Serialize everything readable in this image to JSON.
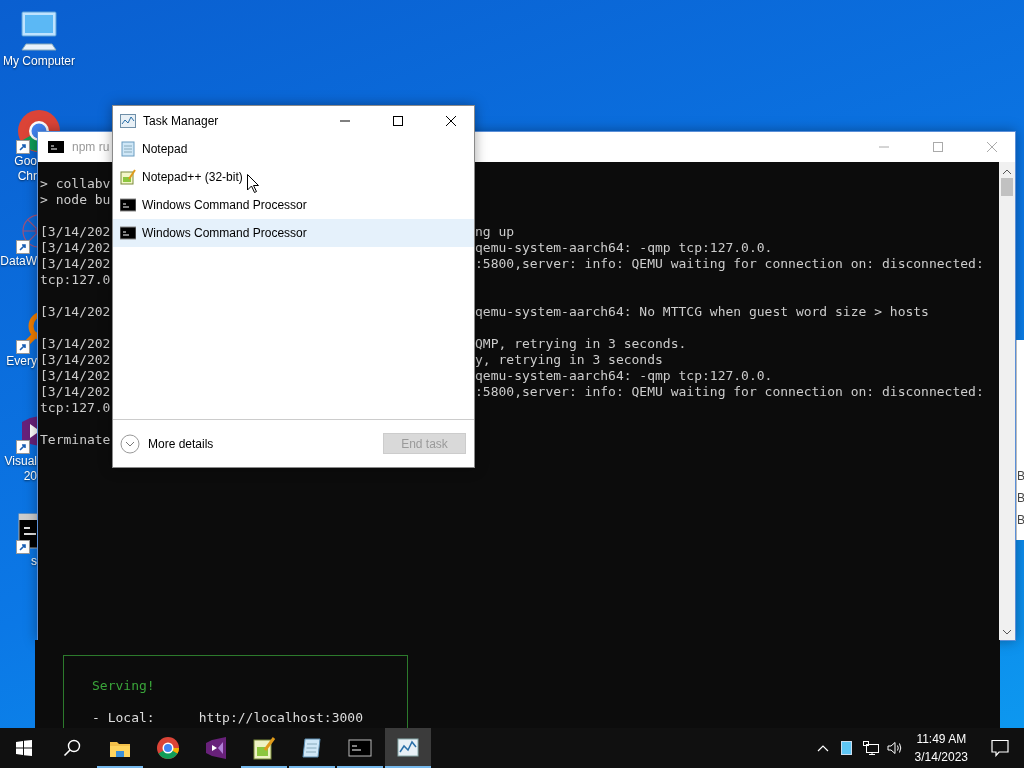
{
  "desktop_icons": [
    {
      "kind": "computer",
      "shortcut": false,
      "label_lines": [
        "My Computer"
      ]
    },
    {
      "kind": "chrome",
      "shortcut": true,
      "label_lines": [
        "Goo",
        "Chr"
      ]
    },
    {
      "kind": "network",
      "shortcut": true,
      "label_lines": [
        "DataW"
      ]
    },
    {
      "kind": "magnifier",
      "shortcut": true,
      "label_lines": [
        "Every"
      ]
    },
    {
      "kind": "visualstudio",
      "shortcut": true,
      "label_lines": [
        "Visual",
        "20"
      ]
    },
    {
      "kind": "cmd",
      "shortcut": true,
      "label_lines": [
        "s"
      ]
    }
  ],
  "console_window": {
    "title": "npm ru",
    "lines": [
      {
        "kind": "text",
        "left": "> collabv"
      },
      {
        "kind": "text",
        "left": "> node bu"
      },
      {
        "kind": "blank"
      },
      {
        "kind": "text",
        "left": "[3/14/202",
        "right": "ng up"
      },
      {
        "kind": "text",
        "left": "[3/14/202",
        "right": "qemu-system-aarch64: -qmp tcp:127.0.0."
      },
      {
        "kind": "text",
        "left": "[3/14/202",
        "right": ":5800,server: info: QEMU waiting for connection on: disconnected:"
      },
      {
        "kind": "text",
        "left": "tcp:127.0"
      },
      {
        "kind": "blank"
      },
      {
        "kind": "text",
        "left": "[3/14/202",
        "right": "qemu-system-aarch64: No MTTCG when guest word size > hosts"
      },
      {
        "kind": "blank"
      },
      {
        "kind": "text",
        "left": "[3/14/202",
        "right": "QMP, retrying in 3 seconds."
      },
      {
        "kind": "text",
        "left": "[3/14/202",
        "right": "y, retrying in 3 seconds"
      },
      {
        "kind": "text",
        "left": "[3/14/202",
        "right": "qemu-system-aarch64: -qmp tcp:127.0.0."
      },
      {
        "kind": "text",
        "left": "[3/14/202",
        "right": ":5800,server: info: QEMU waiting for connection on: disconnected:"
      },
      {
        "kind": "text",
        "left": "tcp:127.0"
      },
      {
        "kind": "blank"
      },
      {
        "kind": "text",
        "left": "Terminate"
      }
    ]
  },
  "server_window": {
    "heading": "Serving!",
    "local_label": "- Local:",
    "local_url": "http://localhost:3000"
  },
  "side_window": {
    "letters": [
      "B",
      "B",
      "B"
    ]
  },
  "task_manager": {
    "title": "Task Manager",
    "apps": [
      {
        "kind": "notepad",
        "name": "Notepad",
        "selected": false
      },
      {
        "kind": "notepadpp",
        "name": "Notepad++ (32-bit)",
        "selected": false
      },
      {
        "kind": "cmd",
        "name": "Windows Command Processor",
        "selected": false
      },
      {
        "kind": "cmd",
        "name": "Windows Command Processor",
        "selected": true
      }
    ],
    "more_details": "More details",
    "end_task": {
      "label": "End task",
      "disabled": true
    }
  },
  "taskbar": {
    "apps": [
      {
        "kind": "explorer",
        "running": true,
        "active": false
      },
      {
        "kind": "chrome",
        "running": false,
        "active": false
      },
      {
        "kind": "visualstudio",
        "running": false,
        "active": false
      },
      {
        "kind": "notepadpp",
        "running": true,
        "active": false
      },
      {
        "kind": "notepad",
        "running": true,
        "active": false
      },
      {
        "kind": "cmd",
        "running": true,
        "active": false
      },
      {
        "kind": "taskmanager",
        "running": true,
        "active": true
      }
    ],
    "clock": {
      "time": "11:49 AM",
      "date": "3/14/2023"
    }
  }
}
